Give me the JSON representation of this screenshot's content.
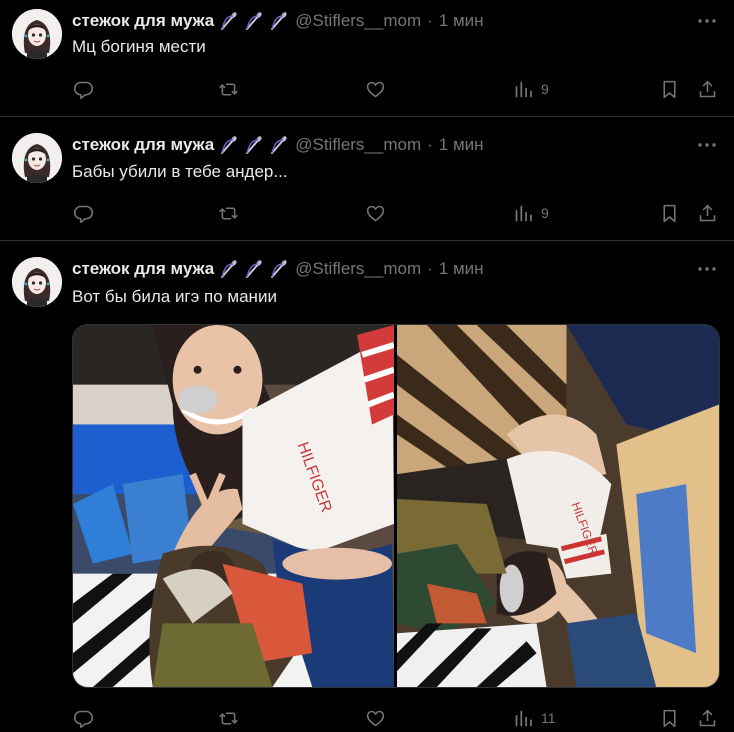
{
  "colors": {
    "background": "#000000",
    "text": "#e7e9ea",
    "secondary": "#71767b",
    "divider": "#2f3336"
  },
  "tweets": [
    {
      "author_name": "стежок для мужа",
      "handle": "@Stiflers__mom",
      "separator": "·",
      "time": "1 мин",
      "text": "Мц богиня мести",
      "views": "9",
      "icons": [
        "needle-icon",
        "reply-icon",
        "retweet-icon",
        "like-icon",
        "views-icon",
        "bookmark-icon",
        "share-icon",
        "more-icon"
      ]
    },
    {
      "author_name": "стежок для мужа",
      "handle": "@Stiflers__mom",
      "separator": "·",
      "time": "1 мин",
      "text": "Бабы убили в тебе андер...",
      "views": "9",
      "icons": [
        "needle-icon",
        "reply-icon",
        "retweet-icon",
        "like-icon",
        "views-icon",
        "bookmark-icon",
        "share-icon",
        "more-icon"
      ]
    },
    {
      "author_name": "стежок для мужа",
      "handle": "@Stiflers__mom",
      "separator": "·",
      "time": "1 мин",
      "text": "Вот бы била игэ по мании",
      "views": "11",
      "icons": [
        "needle-icon",
        "reply-icon",
        "retweet-icon",
        "like-icon",
        "views-icon",
        "bookmark-icon",
        "share-icon",
        "more-icon"
      ]
    }
  ]
}
